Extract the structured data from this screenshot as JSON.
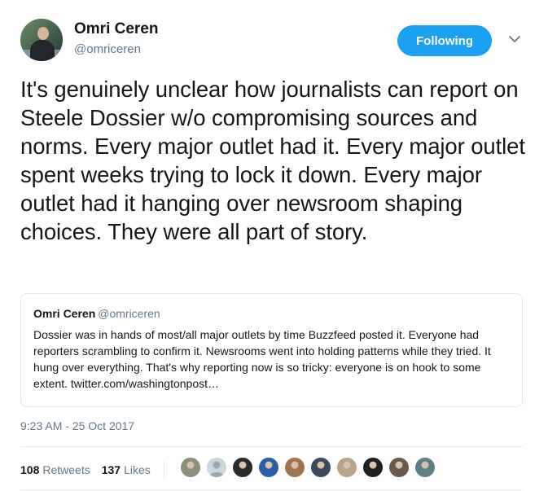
{
  "author": {
    "display_name": "Omri Ceren",
    "screen_name": "@omriceren"
  },
  "follow_button": {
    "label": "Following",
    "color": "#1da1f2"
  },
  "tweet_text": "It's genuinely unclear how journalists can report on Steele Dossier w/o compromising sources and norms. Every major outlet had it. Every major outlet spent weeks trying to lock it down. Every major outlet had it hanging over newsroom shaping choices. They were all part of story.",
  "quoted_tweet": {
    "display_name": "Omri Ceren",
    "screen_name": "@omriceren",
    "text": "Dossier was in hands of most/all major outlets by time Buzzfeed posted it. Everyone had reporters scrambling to confirm it. Newsrooms went into holding patterns while they tried. It hung over everything. That's why reporting now is so tricky: everyone is on hook to some extent. twitter.com/washingtonpost…"
  },
  "timestamp": "9:23 AM - 25 Oct 2017",
  "stats": {
    "retweets_count": "108",
    "retweets_label": "Retweets",
    "likes_count": "137",
    "likes_label": "Likes"
  },
  "likers": [
    {
      "color": "#8c8f7a",
      "icon": "avatar-photo"
    },
    {
      "color": "#ccd6dd",
      "icon": "default-avatar"
    },
    {
      "color": "#2b2b2b",
      "icon": "avatar-photo"
    },
    {
      "color": "#2a5fa8",
      "icon": "avatar-photo"
    },
    {
      "color": "#a0744f",
      "icon": "avatar-photo"
    },
    {
      "color": "#3a4a5c",
      "icon": "avatar-photo"
    },
    {
      "color": "#b8a58a",
      "icon": "avatar-photo"
    },
    {
      "color": "#1f1f1f",
      "icon": "avatar-photo"
    },
    {
      "color": "#6b5a4a",
      "icon": "avatar-photo"
    },
    {
      "color": "#5f7f86",
      "icon": "avatar-photo"
    }
  ],
  "colors": {
    "text": "#14171a",
    "muted": "#657786",
    "border": "#e1e8ed"
  }
}
